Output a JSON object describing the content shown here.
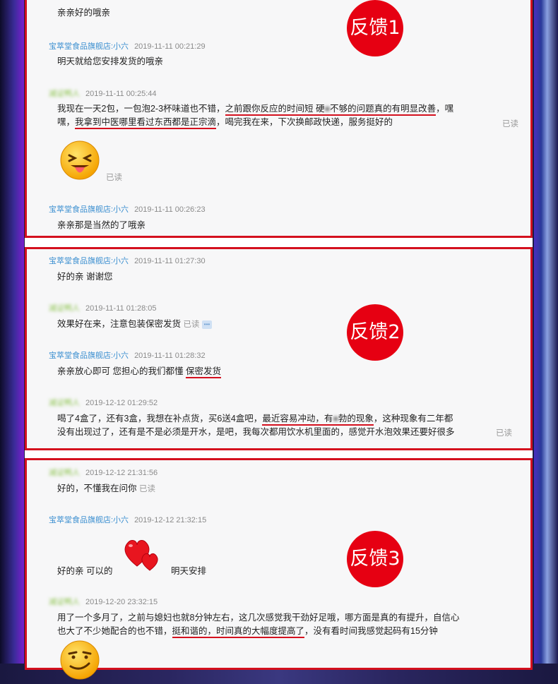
{
  "badges": [
    "反馈1",
    "反馈2",
    "反馈3"
  ],
  "shop_name": "宝萃堂食品旗舰店:小六",
  "customer_name": "减证鸭人",
  "read_label": "已读",
  "panel1": {
    "m0_text": "亲亲好的哦亲",
    "m1_time": "2019-11-11 00:21:29",
    "m1_text": "明天就给您安排发货的哦亲",
    "m2_time": "2019-11-11 00:25:44",
    "m2_l1_a": "我现在一天2包，一包泡2-3杯味道也不错，",
    "m2_l1_u1": "之前跟你反应的时间短 硬",
    "m2_l1_u2": "不够的问题真的有明显改善",
    "m2_l1_b": "，嘿",
    "m2_l2_a": "嘿，",
    "m2_l2_u": "我拿到中医哪里看过东西都是正宗滴",
    "m2_l2_b": "，喝完我在来，下次换邮政快递，服务挺好的",
    "m3_time": "2019-11-11 00:26:23",
    "m3_text": "亲亲那是当然的了哦亲"
  },
  "panel2": {
    "m1_time": "2019-11-11 01:27:30",
    "m1_text": "好的亲 谢谢您",
    "m2_time": "2019-11-11 01:28:05",
    "m2_text": "效果好在来，注意包装保密发货",
    "m3_time": "2019-11-11 01:28:32",
    "m3_text_a": "亲亲放心即可 您担心的我们都懂 ",
    "m3_text_u": "保密发货",
    "m4_time": "2019-12-12 01:29:52",
    "m4_l1_a": "喝了4盒了，还有3盒，我想在补点货，买6送4盒吧，",
    "m4_l1_u1": "最近容易冲动，有",
    "m4_l1_u2": "勃的现象",
    "m4_l1_b": "，这种现象有二年都",
    "m4_l2": "没有出现过了，还有是不是必须是开水，是吧，我每次都用饮水机里面的，感觉开水泡效果还要好很多"
  },
  "panel3": {
    "m1_time": "2019-12-12 21:31:56",
    "m1_text": "好的，不懂我在问你",
    "m2_time": "2019-12-12 21:32:15",
    "m2_text_a": "好的亲 可以的",
    "m2_text_b": "明天安排",
    "m3_time": "2019-12-20 23:32:15",
    "m3_l1": "用了一个多月了，之前与媳妇也就8分钟左右，这几次感觉我干劲好足哦，哪方面是真的有提升，自信心",
    "m3_l2_a": "也大了不少她配合的也不错，",
    "m3_l2_u": "挺和谐的，时间真的大幅度提高了",
    "m3_l2_b": "，没有看时间我感觉起码有15分钟"
  }
}
